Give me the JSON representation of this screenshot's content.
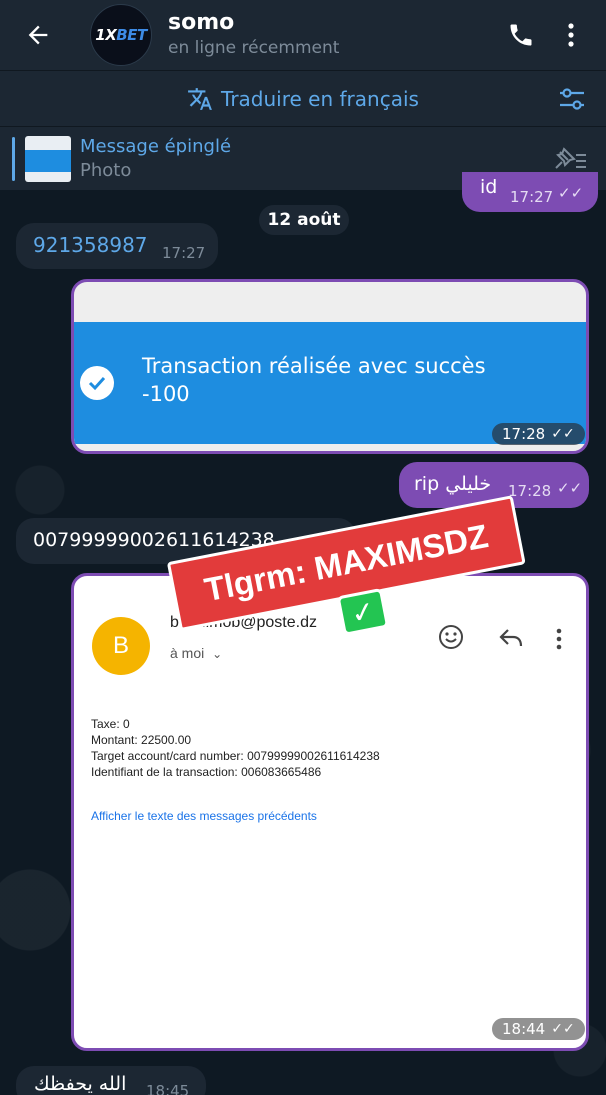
{
  "header": {
    "chat_name": "somo",
    "status": "en ligne récemment",
    "avatar_text_a": "1X",
    "avatar_text_b": "BET"
  },
  "translate_bar": {
    "label": "Traduire en français"
  },
  "pinned": {
    "title": "Message épinglé",
    "subtitle": "Photo"
  },
  "messages": {
    "top_out": {
      "text": "id",
      "time": "17:27"
    },
    "date_chip": "12 août",
    "msg1": {
      "text": "921358987",
      "time": "17:27"
    },
    "photo1": {
      "line1": "Transaction réalisée avec succès",
      "line2": "-100",
      "time": "17:28"
    },
    "out2": {
      "text": "rip خليلي",
      "time": "17:28"
    },
    "msg3": {
      "text": "00799999002611614238"
    },
    "email": {
      "avatar_letter": "B",
      "sender": "baridimob@poste.dz",
      "to": "à moi",
      "lines": [
        "Taxe: 0",
        "Montant: 22500.00",
        "Target account/card number: 00799999002611614238",
        "Identifiant de la transaction: 006083665486"
      ],
      "link": "Afficher le texte des messages précédents",
      "time": "18:44"
    },
    "last_in": {
      "text": "الله يحفظك",
      "time": "18:45"
    }
  },
  "watermark": {
    "text": "Tlgrm: MAXIMSDZ",
    "check": "✓"
  },
  "colors": {
    "accent": "#5ea8e8",
    "outgoing": "#7d4cb3",
    "incoming": "#1c2733",
    "success_blue": "#1e8de0"
  }
}
